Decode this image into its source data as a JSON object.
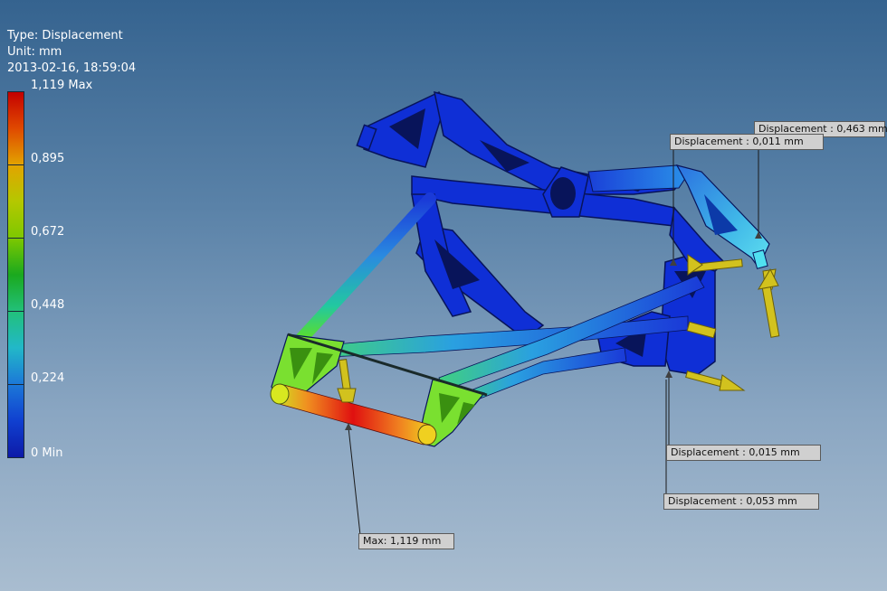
{
  "result_info": {
    "type": "Type: Displacement",
    "unit": "Unit: mm",
    "timestamp": "2013-02-16, 18:59:04"
  },
  "legend": {
    "labels": [
      "1,119 Max",
      "0,895",
      "0,672",
      "0,448",
      "0,224",
      "0 Min"
    ],
    "colors": [
      "#c40000",
      "#e2a400",
      "#7dc800",
      "#1aa91e",
      "#22b8c8",
      "#0d1aa8"
    ]
  },
  "probes": {
    "max": "Max: 1,119 mm",
    "d_0463": "Displacement : 0,463 mm",
    "d_0011": "Displacement : 0,011 mm",
    "d_0015": "Displacement : 0,015 mm",
    "d_0053": "Displacement : 0,053 mm"
  },
  "colors": {
    "frame": "#0f2fd6",
    "arrow": "#d2c21e"
  }
}
